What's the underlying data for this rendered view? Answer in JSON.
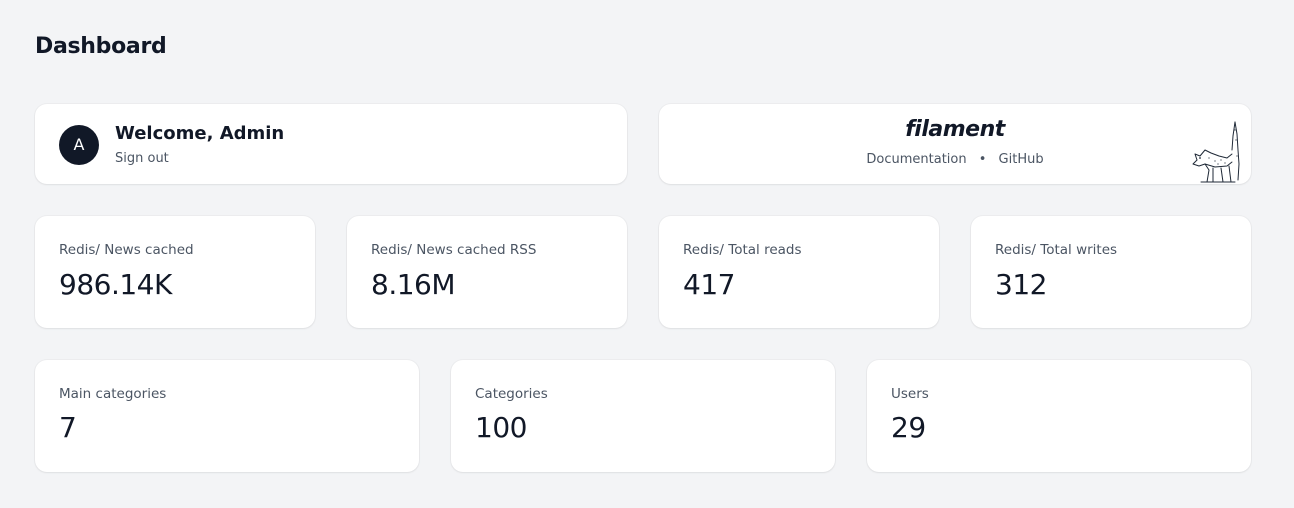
{
  "page": {
    "title": "Dashboard"
  },
  "account": {
    "avatar_initial": "A",
    "welcome": "Welcome, Admin",
    "sign_out": "Sign out"
  },
  "filament_info": {
    "brand": "filament",
    "documentation": "Documentation",
    "separator": "•",
    "github": "GitHub"
  },
  "stats_row1": [
    {
      "label": "Redis/ News cached",
      "value": "986.14K"
    },
    {
      "label": "Redis/ News cached RSS",
      "value": "8.16M"
    },
    {
      "label": "Redis/ Total reads",
      "value": "417"
    },
    {
      "label": "Redis/ Total writes",
      "value": "312"
    }
  ],
  "stats_row2": [
    {
      "label": "Main categories",
      "value": "7"
    },
    {
      "label": "Categories",
      "value": "100"
    },
    {
      "label": "Users",
      "value": "29"
    }
  ]
}
